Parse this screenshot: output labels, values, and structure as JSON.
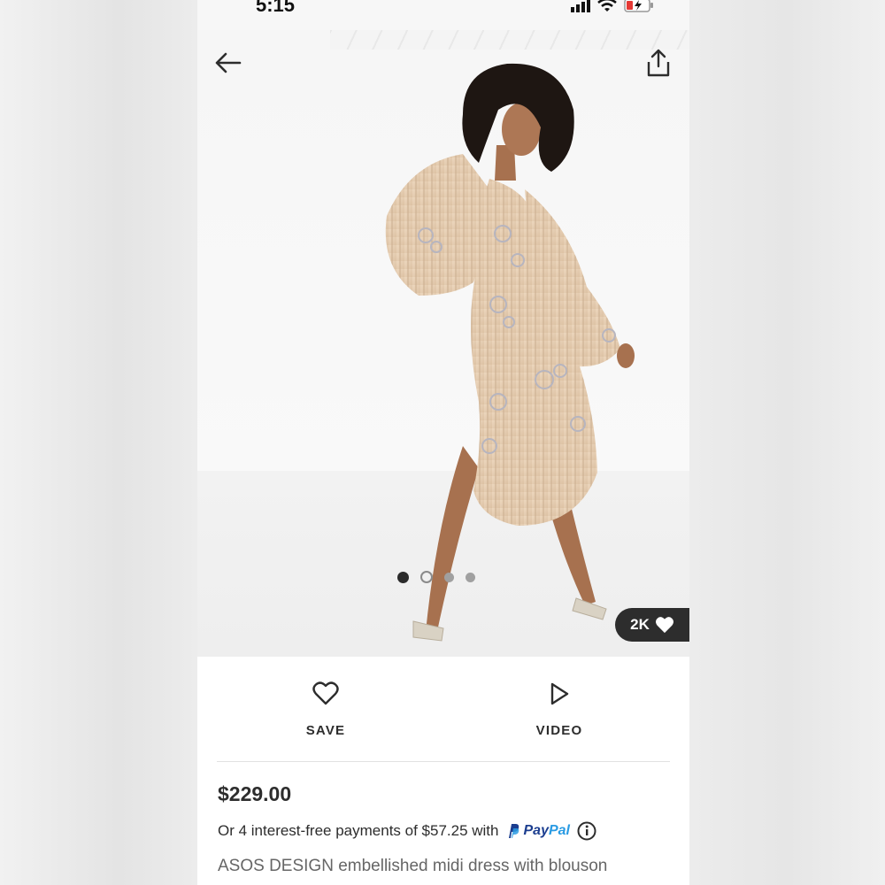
{
  "status_bar": {
    "time": "5:15"
  },
  "product": {
    "likes": "2K",
    "price": "$229.00",
    "installments_text": "Or 4 interest-free payments of $57.25 with",
    "paypal": {
      "p": "Pay",
      "pal": "Pal"
    },
    "description": "ASOS DESIGN embellished midi dress with blouson"
  },
  "actions": {
    "save_label": "SAVE",
    "video_label": "VIDEO"
  },
  "gallery": {
    "count": 4,
    "active_index": 0
  },
  "colors": {
    "dress": "#e8cfb4",
    "dark": "#2d2d2d",
    "paypal_dark": "#1b3d8f",
    "paypal_light": "#2a9be3"
  },
  "icons": [
    "back-arrow-icon",
    "share-icon",
    "heart-icon",
    "play-icon",
    "info-icon",
    "wifi-icon",
    "battery-icon",
    "signal-icon"
  ]
}
